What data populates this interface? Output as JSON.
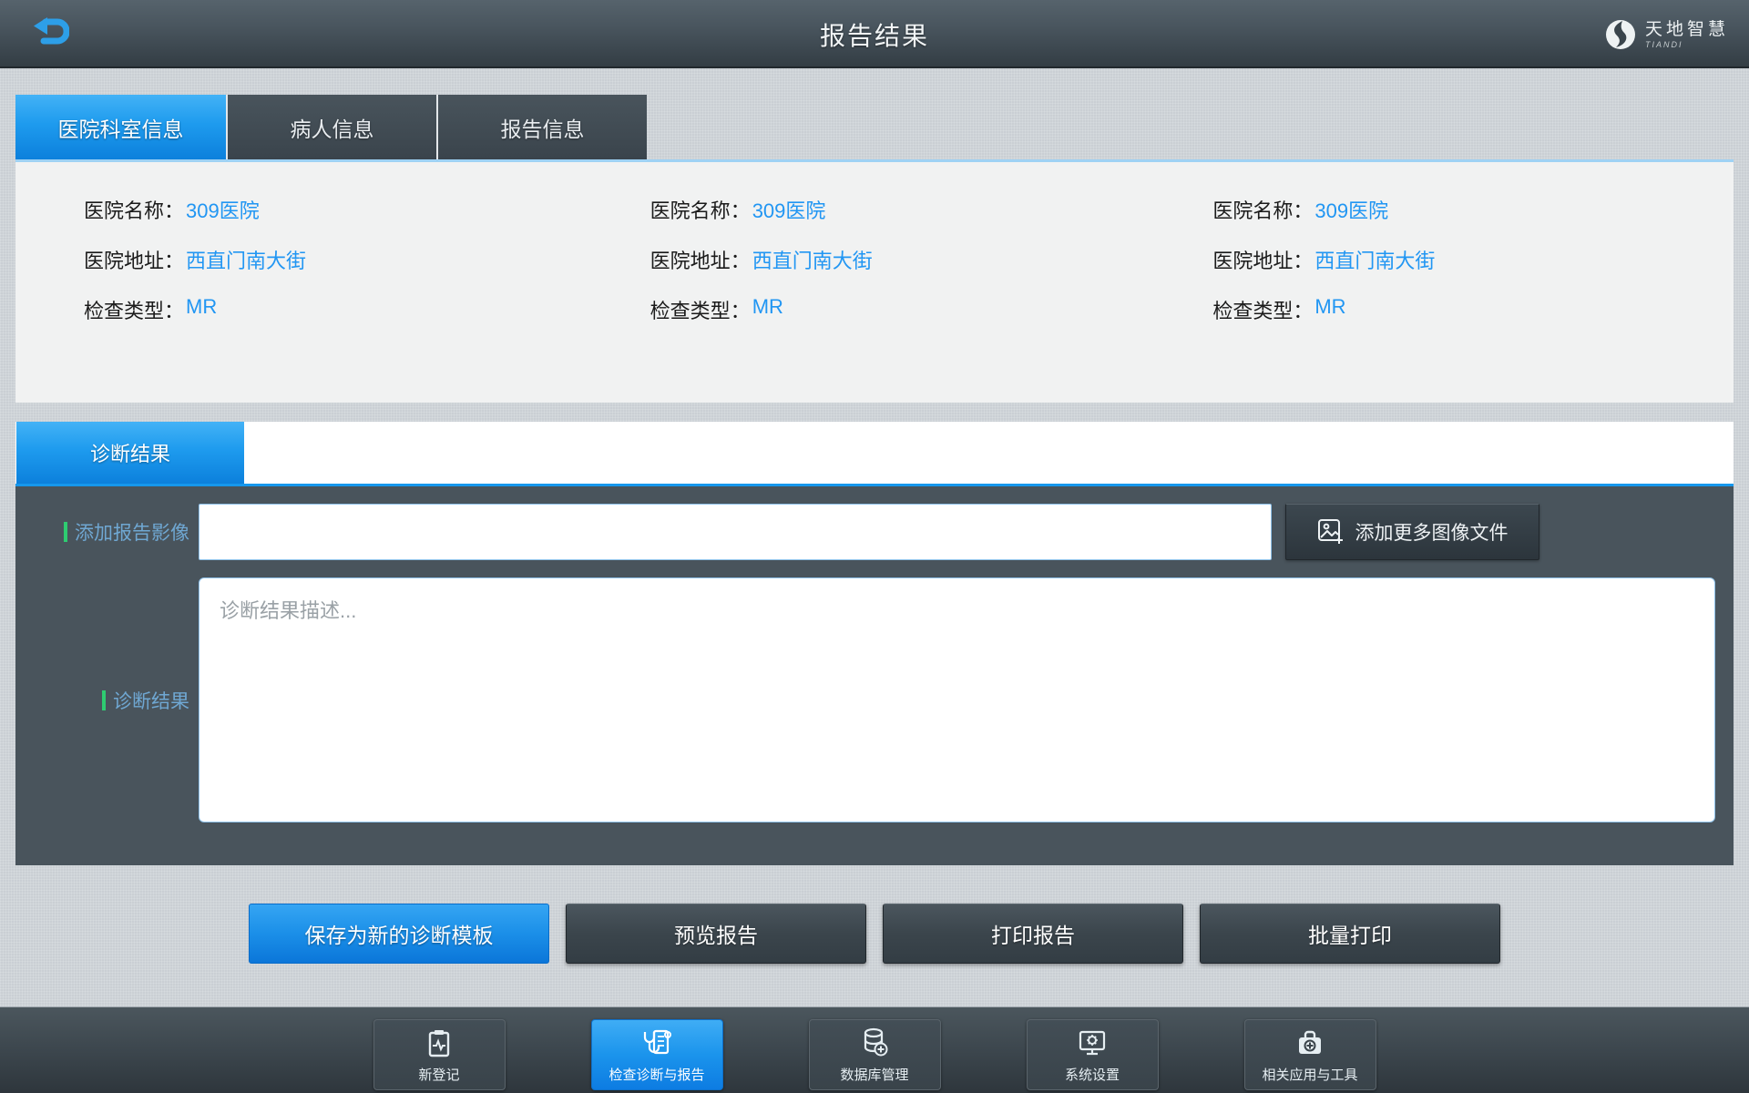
{
  "header": {
    "title": "报告结果",
    "back_icon": "back-arrow-icon",
    "logo_text": "天地智慧",
    "logo_subtext": "TIANDI"
  },
  "tabs": [
    {
      "label": "医院科室信息",
      "active": true
    },
    {
      "label": "病人信息",
      "active": false
    },
    {
      "label": "报告信息",
      "active": false
    }
  ],
  "info_panel": {
    "columns": [
      {
        "fields": [
          {
            "label": "医院名称：",
            "value": "309医院"
          },
          {
            "label": "医院地址：",
            "value": "西直门南大街"
          },
          {
            "label": "检查类型：",
            "value": "MR"
          }
        ]
      },
      {
        "fields": [
          {
            "label": "医院名称：",
            "value": "309医院"
          },
          {
            "label": "医院地址：",
            "value": "西直门南大街"
          },
          {
            "label": "检查类型：",
            "value": "MR"
          }
        ]
      },
      {
        "fields": [
          {
            "label": "医院名称：",
            "value": "309医院"
          },
          {
            "label": "医院地址：",
            "value": "西直门南大街"
          },
          {
            "label": "检查类型：",
            "value": "MR"
          }
        ]
      }
    ]
  },
  "diagnosis": {
    "tab_label": "诊断结果",
    "image_label": "添加报告影像",
    "image_input_value": "",
    "add_button_label": "添加更多图像文件",
    "add_button_icon": "add-image-icon",
    "result_label": "诊断结果",
    "result_placeholder": "诊断结果描述..."
  },
  "actions": [
    {
      "label": "保存为新的诊断模板",
      "primary": true
    },
    {
      "label": "预览报告",
      "primary": false
    },
    {
      "label": "打印报告",
      "primary": false
    },
    {
      "label": "批量打印",
      "primary": false
    }
  ],
  "bottom_nav": [
    {
      "label": "新登记",
      "icon": "clipboard-ecg-icon",
      "active": false
    },
    {
      "label": "检查诊断与报告",
      "icon": "stethoscope-report-icon",
      "active": true
    },
    {
      "label": "数据库管理",
      "icon": "database-add-icon",
      "active": false
    },
    {
      "label": "系统设置",
      "icon": "monitor-settings-icon",
      "active": false
    },
    {
      "label": "相关应用与工具",
      "icon": "toolbox-add-icon",
      "active": false
    }
  ],
  "colors": {
    "accent_blue": "#2196f3",
    "active_tab_top": "#43b2f6",
    "active_tab_bottom": "#0c80dc",
    "panel_dark": "#49545c",
    "green_accent": "#2ecc71",
    "background": "#cacfd4"
  }
}
